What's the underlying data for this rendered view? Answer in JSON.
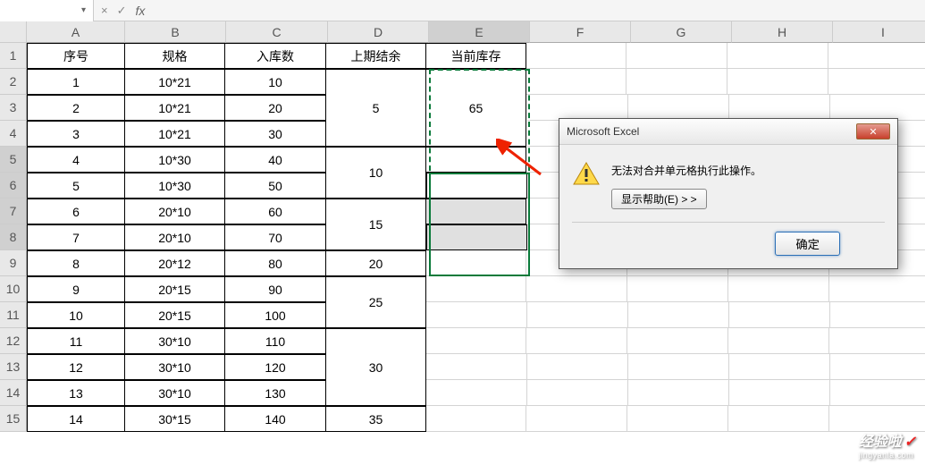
{
  "formula_bar": {
    "name_box": "",
    "cancel": "×",
    "confirm": "✓",
    "fx": "fx",
    "formula": ""
  },
  "columns": [
    "A",
    "B",
    "C",
    "D",
    "E",
    "F",
    "G",
    "H",
    "I"
  ],
  "rows": [
    "1",
    "2",
    "3",
    "4",
    "5",
    "6",
    "7",
    "8",
    "9",
    "10",
    "11",
    "12",
    "13",
    "14",
    "15"
  ],
  "headers": {
    "A": "序号",
    "B": "规格",
    "C": "入库数",
    "D": "上期结余",
    "E": "当前库存"
  },
  "data": [
    {
      "a": "1",
      "b": "10*21",
      "c": "10"
    },
    {
      "a": "2",
      "b": "10*21",
      "c": "20"
    },
    {
      "a": "3",
      "b": "10*21",
      "c": "30"
    },
    {
      "a": "4",
      "b": "10*30",
      "c": "40"
    },
    {
      "a": "5",
      "b": "10*30",
      "c": "50"
    },
    {
      "a": "6",
      "b": "20*10",
      "c": "60"
    },
    {
      "a": "7",
      "b": "20*10",
      "c": "70"
    },
    {
      "a": "8",
      "b": "20*12",
      "c": "80"
    },
    {
      "a": "9",
      "b": "20*15",
      "c": "90"
    },
    {
      "a": "10",
      "b": "20*15",
      "c": "100"
    },
    {
      "a": "11",
      "b": "30*10",
      "c": "110"
    },
    {
      "a": "12",
      "b": "30*10",
      "c": "120"
    },
    {
      "a": "13",
      "b": "30*10",
      "c": "130"
    },
    {
      "a": "14",
      "b": "30*15",
      "c": "140"
    }
  ],
  "merged_d": [
    {
      "start": 1,
      "span": 3,
      "val": "5"
    },
    {
      "start": 4,
      "span": 2,
      "val": "10"
    },
    {
      "start": 6,
      "span": 2,
      "val": "15"
    },
    {
      "start": 8,
      "span": 1,
      "val": "20"
    },
    {
      "start": 9,
      "span": 2,
      "val": "25"
    },
    {
      "start": 11,
      "span": 3,
      "val": "30"
    },
    {
      "start": 14,
      "span": 1,
      "val": "35"
    }
  ],
  "merged_e": [
    {
      "start": 1,
      "span": 3,
      "val": "65"
    }
  ],
  "dialog": {
    "title": "Microsoft Excel",
    "message": "无法对合并单元格执行此操作。",
    "help": "显示帮助(E) > >",
    "ok": "确定",
    "close": "✕"
  },
  "watermark": {
    "main": "经验啦",
    "check": "✓",
    "sub": "jingyanla.com"
  }
}
